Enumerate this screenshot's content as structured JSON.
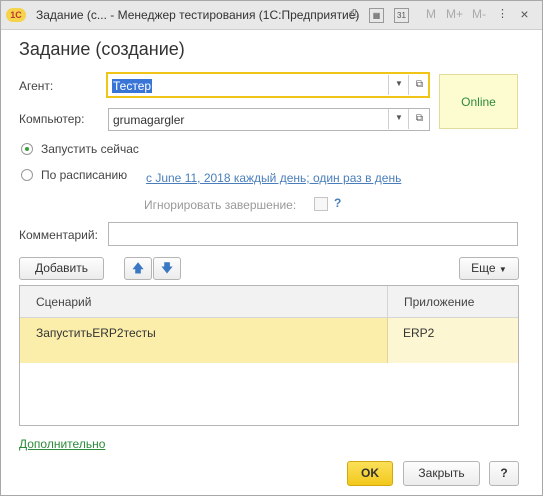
{
  "titlebar": {
    "logo": "1С",
    "title": "Задание (с...  - Менеджер тестирования (1С:Предприятие)",
    "m": "M",
    "m_plus": "M+",
    "m_minus": "M-"
  },
  "form": {
    "header": "Задание (создание)",
    "agent_label": "Агент:",
    "agent_value": "Тестер",
    "online_status": "Online",
    "computer_label": "Компьютер:",
    "computer_value": "grumagargler",
    "run_now_label": "Запустить сейчас",
    "schedule_label": "По расписанию",
    "schedule_link": "с June 11, 2018 каждый день; один раз в день",
    "ignore_label": "Игнорировать завершение:",
    "ignore_help": "?",
    "comment_label": "Комментарий:",
    "comment_value": ""
  },
  "toolbar": {
    "add_label": "Добавить",
    "more_label": "Еще"
  },
  "table": {
    "columns": [
      "Сценарий",
      "Приложение"
    ],
    "rows": [
      {
        "scenario": "ЗапуститьERP2тесты",
        "application": "ERP2"
      }
    ]
  },
  "footer": {
    "more_link": "Дополнительно",
    "ok_label": "OK",
    "close_label": "Закрыть",
    "help_label": "?"
  },
  "colors": {
    "accent_yellow": "#f5d34a",
    "online_bg": "#fdfbd0",
    "link": "#4a7eba",
    "green_link": "#2e8b3a",
    "focus_border": "#f0c419"
  }
}
